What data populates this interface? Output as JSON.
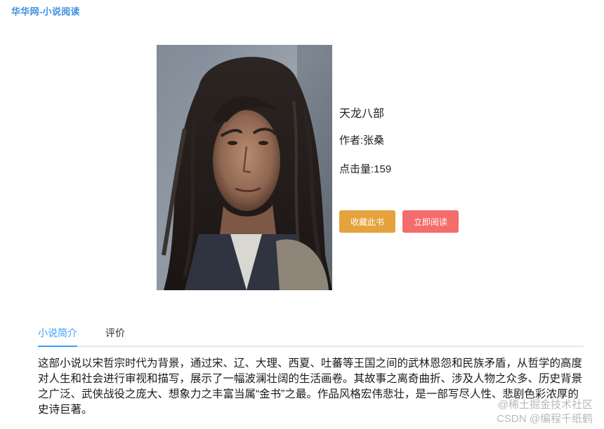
{
  "header": {
    "site_title": "华华网-小说阅读"
  },
  "book": {
    "cover_alt": "小说封面",
    "title": "天龙八部",
    "author": "作者:张桑",
    "clicks": "点击量:159"
  },
  "actions": {
    "collect_label": "收藏此书",
    "read_label": "立即阅读"
  },
  "tabs": [
    {
      "label": "小说简介",
      "active": true
    },
    {
      "label": "评价",
      "active": false
    }
  ],
  "description": "这部小说以宋哲宗时代为背景，通过宋、辽、大理、西夏、吐蕃等王国之间的武林恩怨和民族矛盾，从哲学的高度对人生和社会进行审视和描写，展示了一幅波澜壮阔的生活画卷。其故事之离奇曲折、涉及人物之众多、历史背景之广泛、武侠战役之庞大、想象力之丰富当属“金书”之最。作品风格宏伟悲壮，是一部写尽人性、悲剧色彩浓厚的史诗巨著。",
  "watermark": {
    "line1": "@稀土掘金技术社区",
    "line2": "CSDN @编程千纸鹤"
  },
  "colors": {
    "brand": "#3d8fe0",
    "collect_button": "#e6a23c",
    "read_button": "#f56c6c",
    "tab_active": "#409eff",
    "tab_border": "#e4e7ed"
  }
}
